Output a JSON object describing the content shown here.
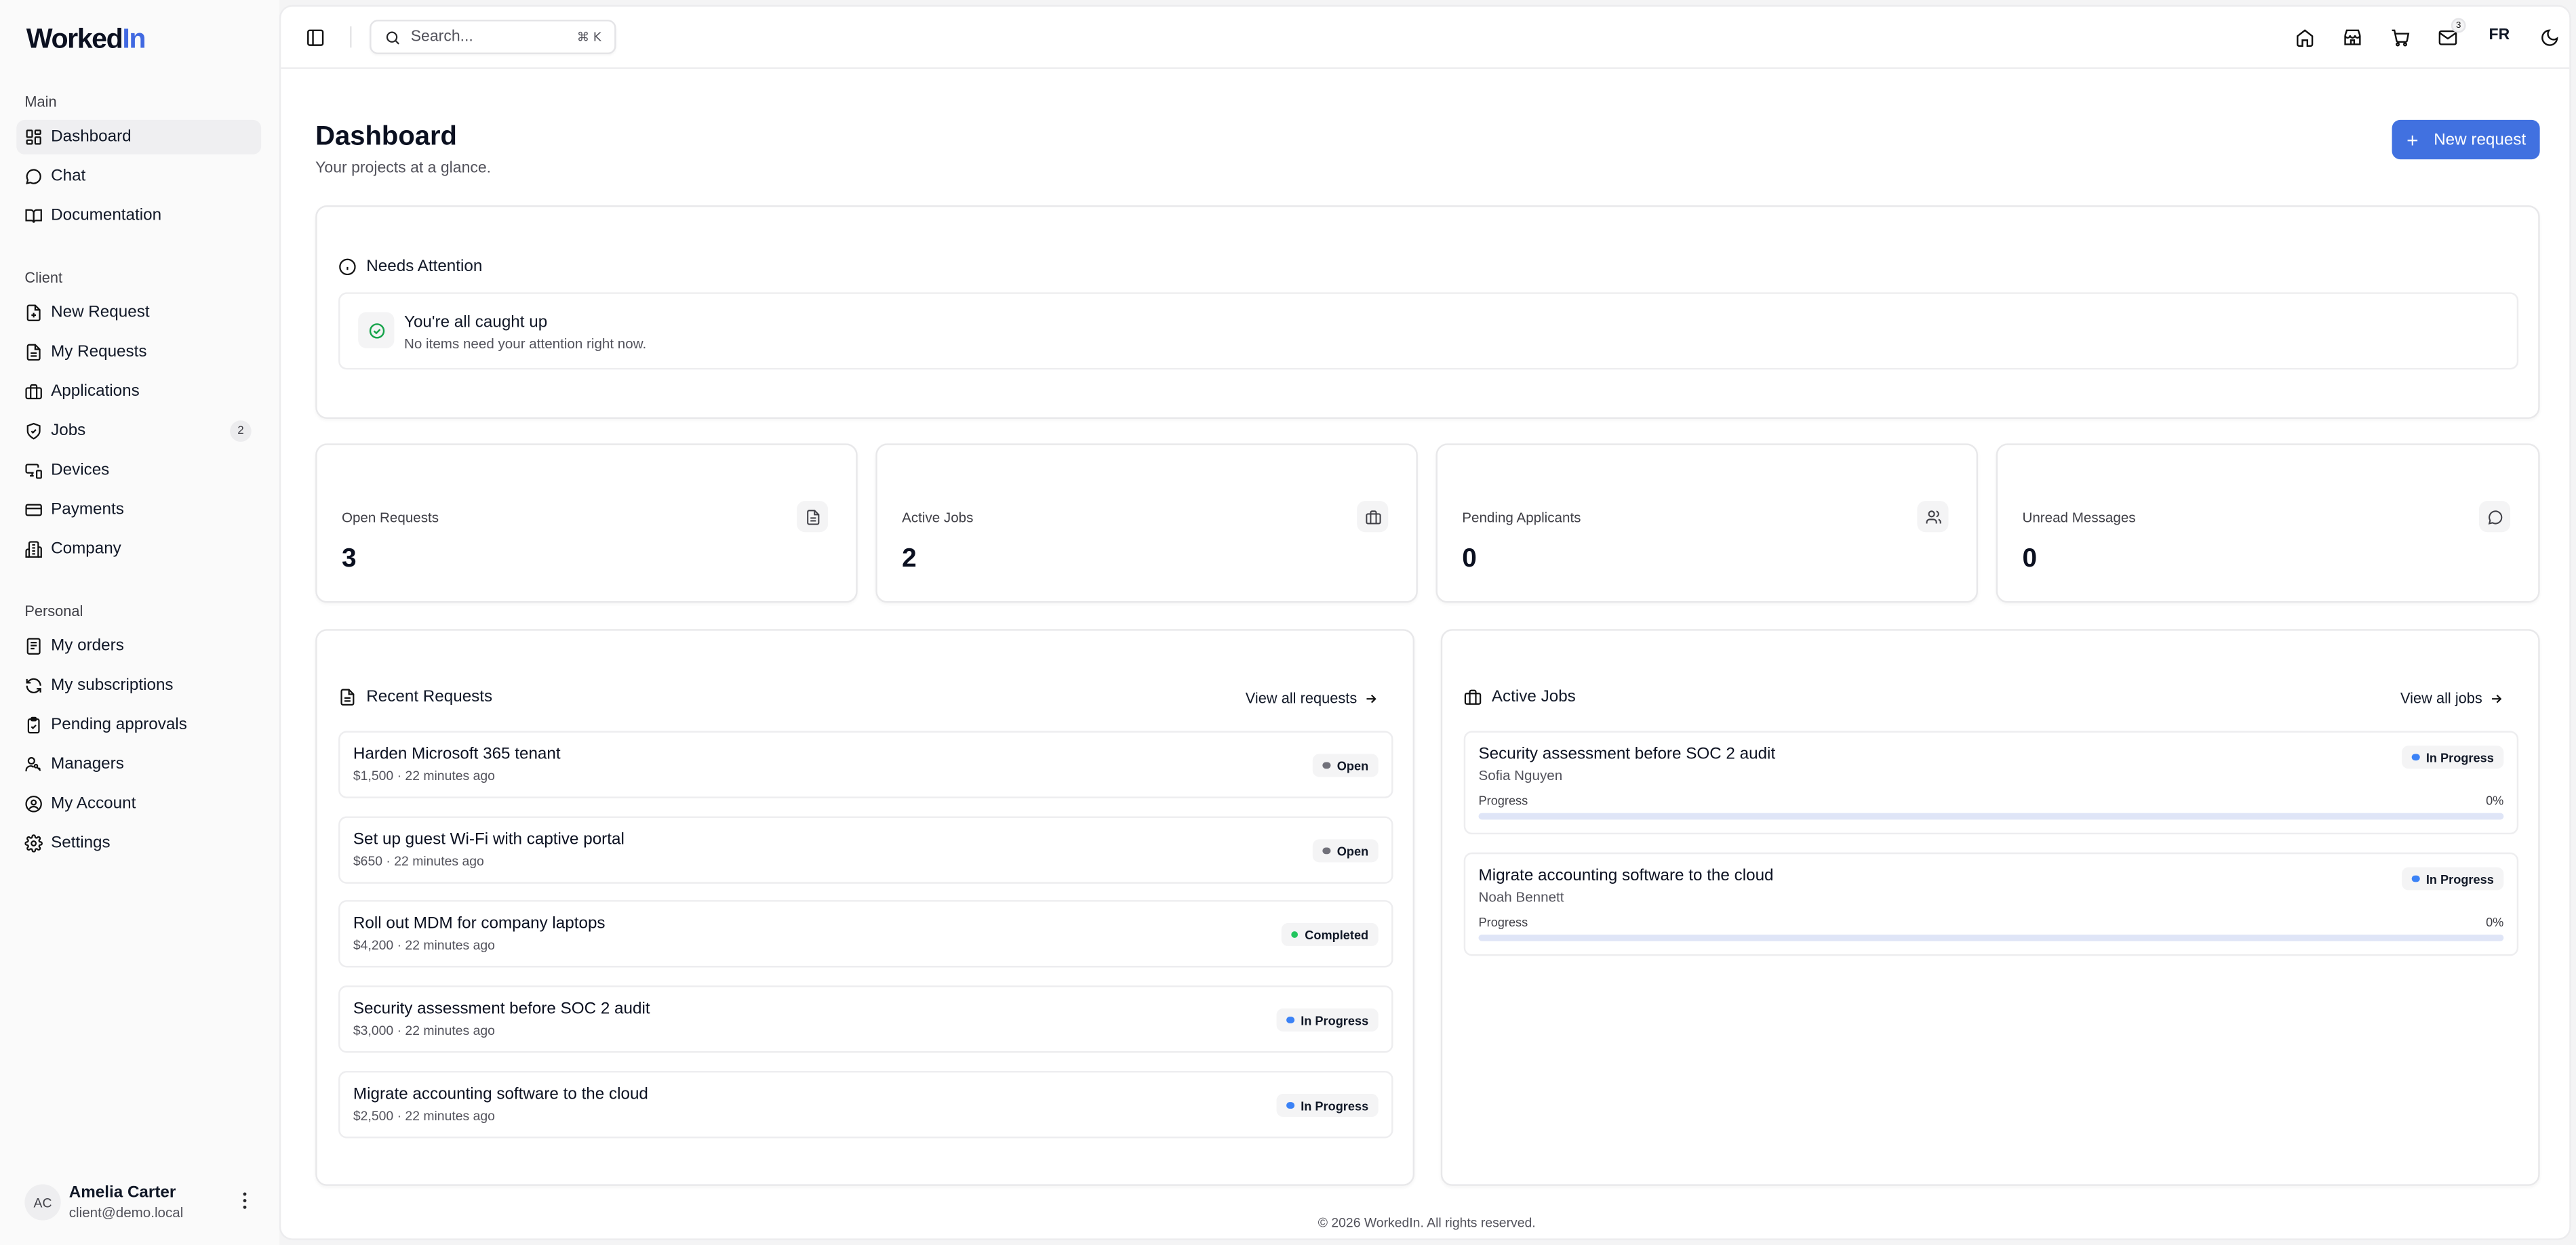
{
  "brand": {
    "name_part1": "Worked",
    "name_part2": "In",
    "accent": "#4169e1"
  },
  "sidebar": {
    "groups": [
      {
        "label": "Main",
        "items": [
          {
            "label": "Dashboard",
            "icon": "layout-grid-icon",
            "active": true
          },
          {
            "label": "Chat",
            "icon": "message-circle-icon"
          },
          {
            "label": "Documentation",
            "icon": "book-open-icon"
          }
        ]
      },
      {
        "label": "Client",
        "items": [
          {
            "label": "New Request",
            "icon": "file-plus-icon"
          },
          {
            "label": "My Requests",
            "icon": "file-text-icon"
          },
          {
            "label": "Applications",
            "icon": "briefcase-icon"
          },
          {
            "label": "Jobs",
            "icon": "shield-check-icon",
            "badge": "2"
          },
          {
            "label": "Devices",
            "icon": "monitor-smartphone-icon"
          },
          {
            "label": "Payments",
            "icon": "credit-card-icon"
          },
          {
            "label": "Company",
            "icon": "building-icon"
          }
        ]
      },
      {
        "label": "Personal",
        "items": [
          {
            "label": "My orders",
            "icon": "receipt-icon"
          },
          {
            "label": "My subscriptions",
            "icon": "refresh-icon"
          },
          {
            "label": "Pending approvals",
            "icon": "clipboard-check-icon"
          },
          {
            "label": "Managers",
            "icon": "user-key-icon"
          },
          {
            "label": "My Account",
            "icon": "user-circle-icon"
          },
          {
            "label": "Settings",
            "icon": "gear-icon"
          }
        ]
      }
    ],
    "user": {
      "initials": "AC",
      "name": "Amelia Carter",
      "email": "client@demo.local"
    }
  },
  "topbar": {
    "search_placeholder": "Search...",
    "shortcut": "⌘ K",
    "mail_badge": "3",
    "language": "FR"
  },
  "header": {
    "title": "Dashboard",
    "subtitle": "Your projects at a glance.",
    "new_request_label": "New request"
  },
  "attention": {
    "title": "Needs Attention",
    "empty_title": "You're all caught up",
    "empty_subtitle": "No items need your attention right now."
  },
  "stats": [
    {
      "label": "Open Requests",
      "value": "3",
      "icon": "file-text-icon"
    },
    {
      "label": "Active Jobs",
      "value": "2",
      "icon": "briefcase-icon"
    },
    {
      "label": "Pending Applicants",
      "value": "0",
      "icon": "users-icon"
    },
    {
      "label": "Unread Messages",
      "value": "0",
      "icon": "message-circle-icon"
    }
  ],
  "recent_requests": {
    "title": "Recent Requests",
    "view_all": "View all requests",
    "items": [
      {
        "title": "Harden Microsoft 365 tenant",
        "meta": "$1,500 · 22 minutes ago",
        "status": "Open",
        "status_color": "#71717a"
      },
      {
        "title": "Set up guest Wi-Fi with captive portal",
        "meta": "$650 · 22 minutes ago",
        "status": "Open",
        "status_color": "#71717a"
      },
      {
        "title": "Roll out MDM for company laptops",
        "meta": "$4,200 · 22 minutes ago",
        "status": "Completed",
        "status_color": "#22c55e"
      },
      {
        "title": "Security assessment before SOC 2 audit",
        "meta": "$3,000 · 22 minutes ago",
        "status": "In Progress",
        "status_color": "#3b82f6"
      },
      {
        "title": "Migrate accounting software to the cloud",
        "meta": "$2,500 · 22 minutes ago",
        "status": "In Progress",
        "status_color": "#3b82f6"
      }
    ]
  },
  "active_jobs": {
    "title": "Active Jobs",
    "view_all": "View all jobs",
    "progress_label": "Progress",
    "items": [
      {
        "title": "Security assessment before SOC 2 audit",
        "person": "Sofia Nguyen",
        "status": "In Progress",
        "progress": "0%",
        "progress_value": 0,
        "status_color": "#3b82f6"
      },
      {
        "title": "Migrate accounting software to the cloud",
        "person": "Noah Bennett",
        "status": "In Progress",
        "progress": "0%",
        "progress_value": 0,
        "status_color": "#3b82f6"
      }
    ]
  },
  "footer": {
    "text": "© 2026 WorkedIn. All rights reserved."
  }
}
